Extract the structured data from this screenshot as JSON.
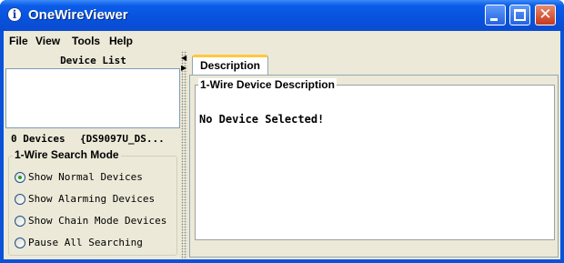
{
  "window": {
    "title": "OneWireViewer",
    "app_icon_glyph": "i",
    "close_glyph": "✕"
  },
  "menu": [
    "File",
    "View",
    "Tools",
    "Help"
  ],
  "left_panel": {
    "device_list_title": "Device List",
    "device_count": "0 Devices",
    "adapter": "{DS9097U_DS...",
    "search_mode": {
      "title": "1-Wire Search Mode",
      "options": [
        {
          "label": "Show Normal Devices",
          "selected": true
        },
        {
          "label": "Show Alarming Devices",
          "selected": false
        },
        {
          "label": "Show Chain Mode Devices",
          "selected": false
        },
        {
          "label": "Pause All Searching",
          "selected": false
        }
      ]
    }
  },
  "right_panel": {
    "tab_label": "Description",
    "group_title": "1-Wire Device Description",
    "message": "No Device Selected!"
  },
  "colors": {
    "titlebar": "#0852dc",
    "client_bg": "#ece9d8",
    "tab_highlight": "#ffc83c"
  },
  "icons": {
    "app": "info-icon",
    "minimize": "minimize-icon",
    "maximize": "maximize-icon",
    "close": "close-icon"
  }
}
